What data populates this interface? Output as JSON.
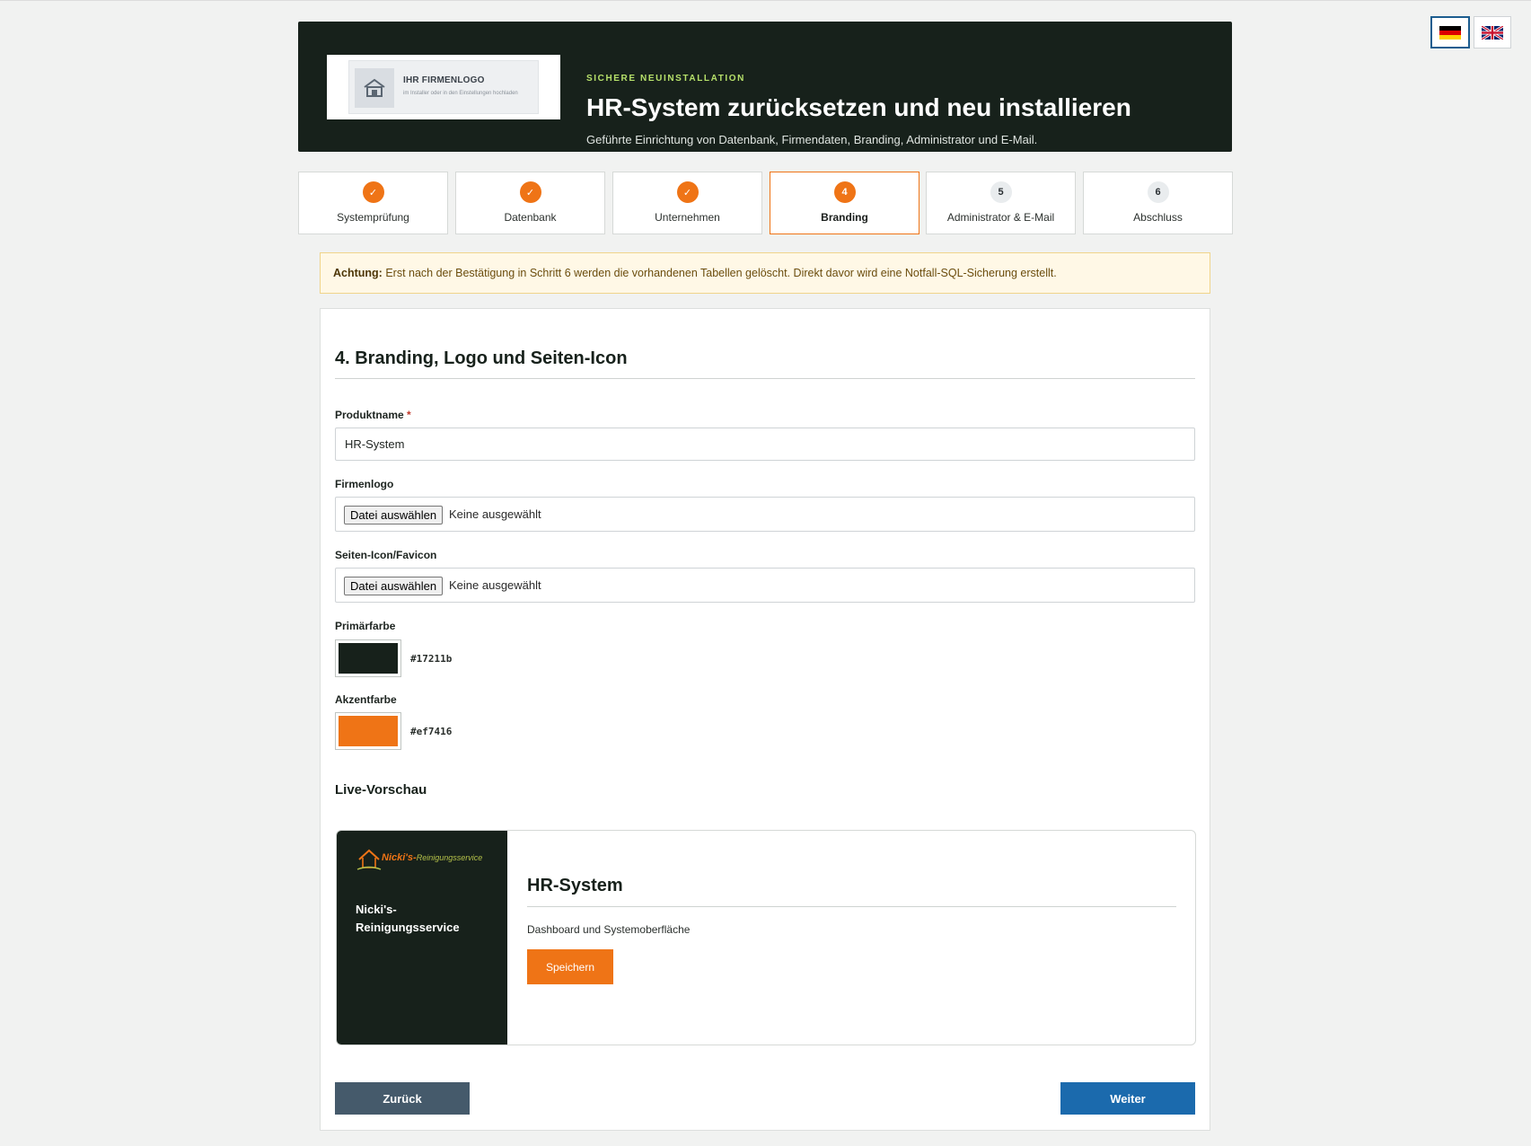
{
  "language_switch": {
    "options": [
      {
        "code": "de",
        "icon": "german-flag-icon",
        "selected": true
      },
      {
        "code": "en",
        "icon": "uk-flag-icon",
        "selected": false
      }
    ]
  },
  "header": {
    "logo_placeholder": {
      "icon": "building-icon",
      "title": "IHR FIRMENLOGO",
      "subtitle": "im Installer oder in den Einstellungen hochladen"
    },
    "eyebrow": "SICHERE NEUINSTALLATION",
    "title": "HR-System zurücksetzen und neu installieren",
    "subtitle": "Geführte Einrichtung von Datenbank, Firmendaten, Branding, Administrator und E-Mail."
  },
  "steps": [
    {
      "badge": "✓",
      "label": "Systemprüfung",
      "state": "done"
    },
    {
      "badge": "✓",
      "label": "Datenbank",
      "state": "done"
    },
    {
      "badge": "✓",
      "label": "Unternehmen",
      "state": "done"
    },
    {
      "badge": "4",
      "label": "Branding",
      "state": "current"
    },
    {
      "badge": "5",
      "label": "Administrator & E-Mail",
      "state": "todo"
    },
    {
      "badge": "6",
      "label": "Abschluss",
      "state": "todo"
    }
  ],
  "alert": {
    "label": "Achtung:",
    "text": " Erst nach der Bestätigung in Schritt 6 werden die vorhandenen Tabellen gelöscht. Direkt davor wird eine Notfall-SQL-Sicherung erstellt."
  },
  "form": {
    "section_title": "4. Branding, Logo und Seiten-Icon",
    "product_name": {
      "label": "Produktname",
      "required_mark": "*",
      "value": "HR-System"
    },
    "company_logo": {
      "label": "Firmenlogo",
      "button": "Datei auswählen",
      "status": "Keine ausgewählt"
    },
    "favicon": {
      "label": "Seiten-Icon/Favicon",
      "button": "Datei auswählen",
      "status": "Keine ausgewählt"
    },
    "primary_color": {
      "label": "Primärfarbe",
      "value": "#17211b"
    },
    "accent_color": {
      "label": "Akzentfarbe",
      "value": "#ef7416"
    }
  },
  "preview": {
    "heading": "Live-Vorschau",
    "logo_text": "Nicki's-",
    "logo_text_suffix": "Reinigungsservice",
    "company": "Nicki's-Reinigungsservice",
    "title": "HR-System",
    "description": "Dashboard und Systemoberfläche",
    "button": "Speichern"
  },
  "navigation": {
    "back": "Zurück",
    "next": "Weiter"
  },
  "colors": {
    "primary": "#17211b",
    "accent": "#ef7416",
    "next_button": "#1b6aad",
    "back_button": "#455a6b"
  }
}
